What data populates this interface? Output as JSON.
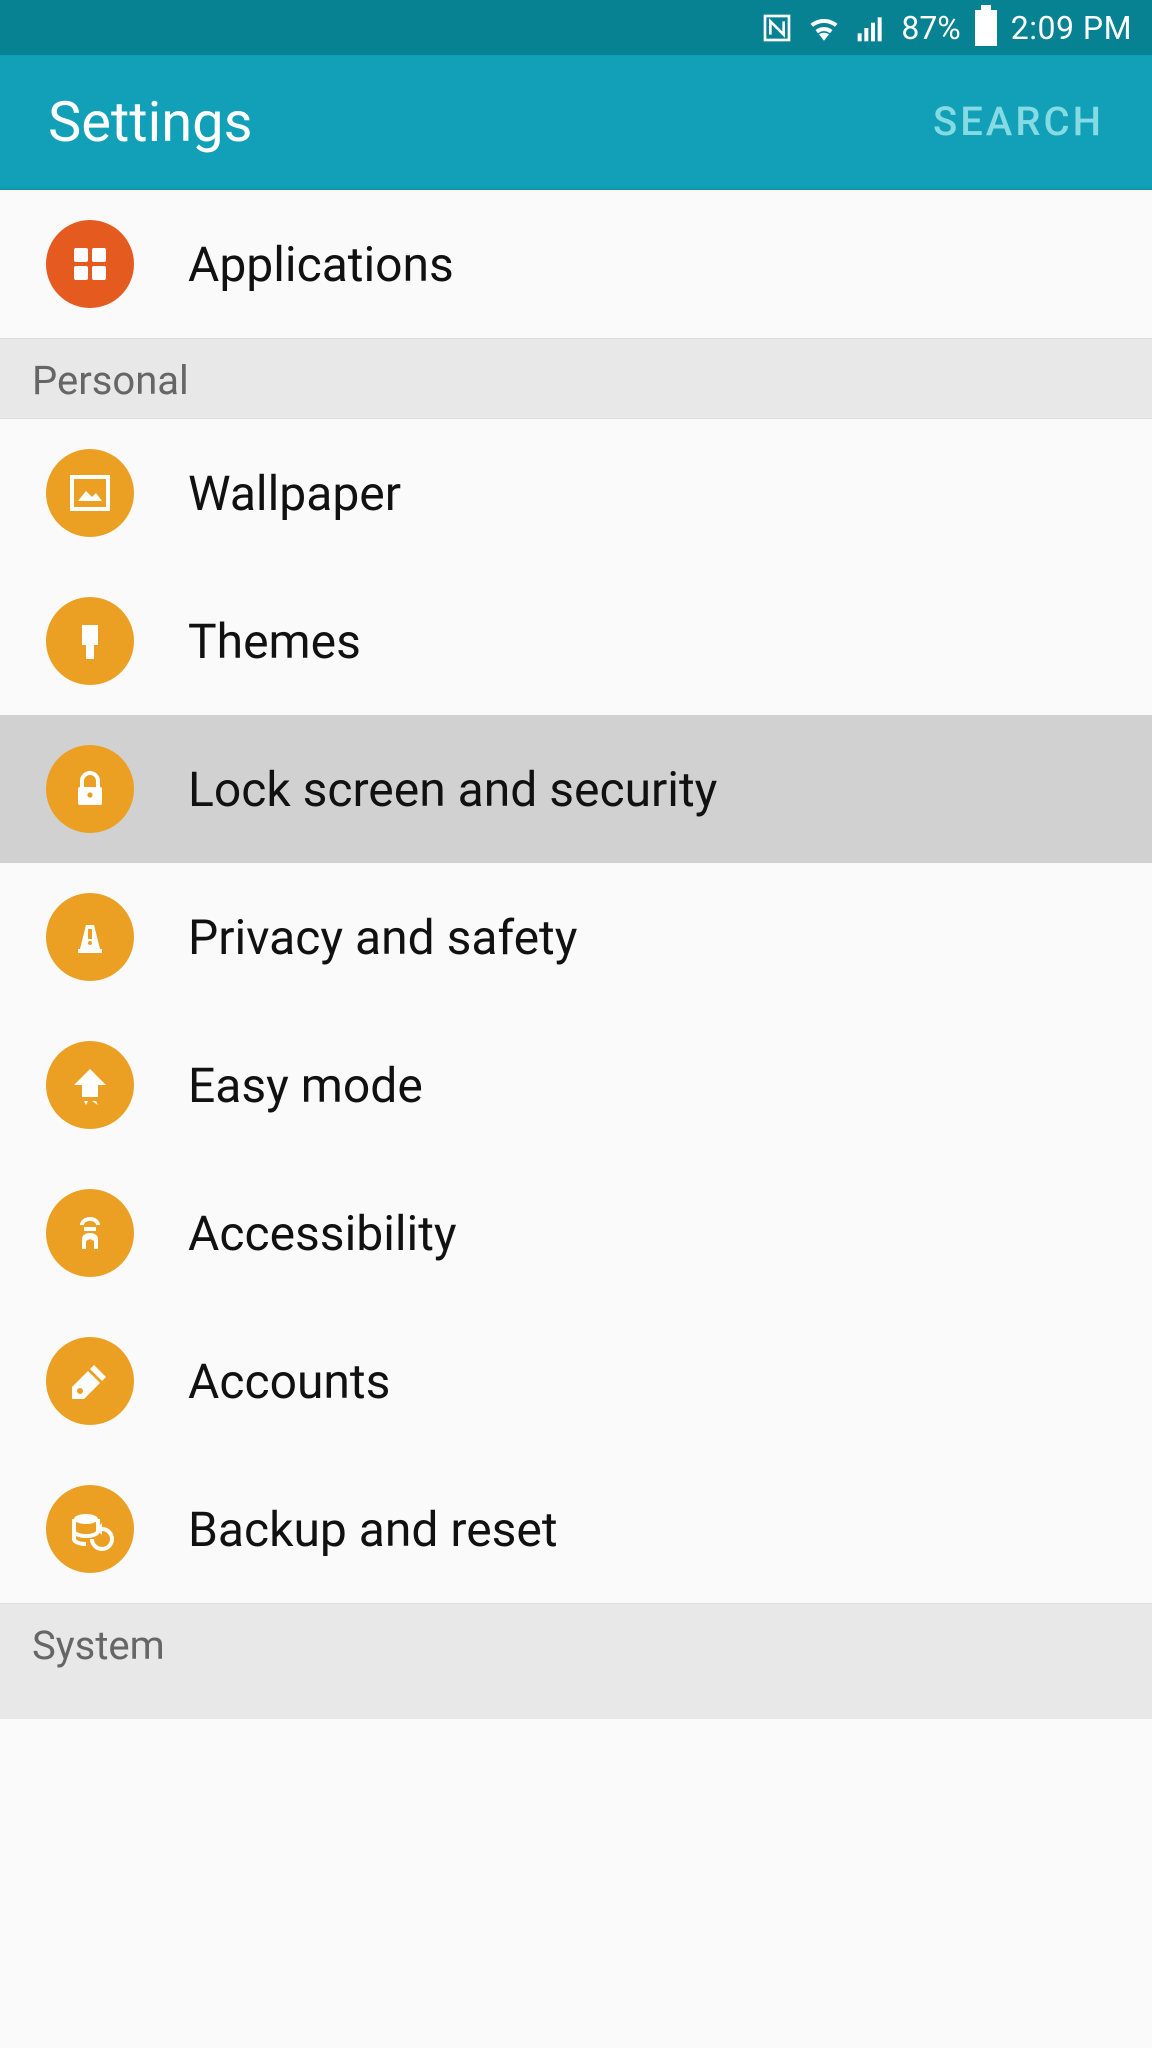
{
  "status": {
    "battery_pct": "87%",
    "time": "2:09 PM"
  },
  "header": {
    "title": "Settings",
    "search": "SEARCH"
  },
  "row_applications": "Applications",
  "section_personal": "Personal",
  "row_wallpaper": "Wallpaper",
  "row_themes": "Themes",
  "row_lock": "Lock screen and security",
  "row_privacy": "Privacy and safety",
  "row_easy": "Easy mode",
  "row_accessibility": "Accessibility",
  "row_accounts": "Accounts",
  "row_backup": "Backup and reset",
  "section_system": "System"
}
